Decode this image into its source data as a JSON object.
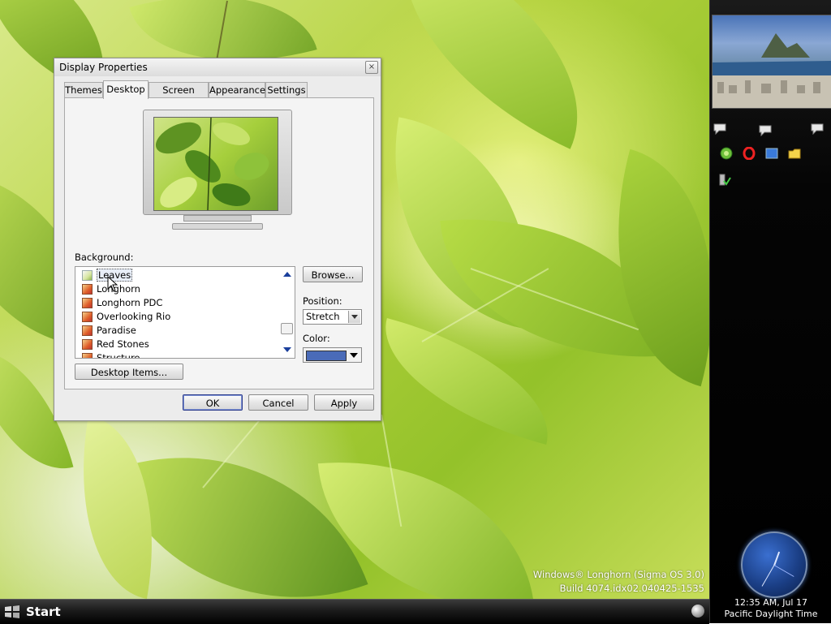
{
  "dialog": {
    "title": "Display Properties",
    "close_glyph": "×",
    "tabs": [
      {
        "label": "Themes",
        "active": false
      },
      {
        "label": "Desktop",
        "active": true
      },
      {
        "label": "Screen Saver",
        "active": false
      },
      {
        "label": "Appearance",
        "active": false
      },
      {
        "label": "Settings",
        "active": false
      }
    ],
    "background": {
      "label": "Background:",
      "items": [
        "Leaves",
        "Longhorn",
        "Longhorn PDC",
        "Overlooking Rio",
        "Paradise",
        "Red Stones",
        "Structure"
      ],
      "selected": "Leaves"
    },
    "browse_label": "Browse...",
    "position": {
      "label": "Position:",
      "value": "Stretch"
    },
    "color": {
      "label": "Color:",
      "value": "#4a6bb8"
    },
    "desktop_items_label": "Desktop Items...",
    "ok_label": "OK",
    "cancel_label": "Cancel",
    "apply_label": "Apply"
  },
  "taskbar": {
    "start_label": "Start"
  },
  "watermark": {
    "line1": "Windows® Longhorn (Sigma OS 3.0)",
    "line2": "Build 4074.idx02.040425-1535"
  },
  "sidebar": {
    "clock_time": "12:35 AM, Jul 17",
    "clock_zone": "Pacific Daylight Time",
    "icons": [
      "chat-icon",
      "chat-icon",
      "chat-icon",
      "globe-icon",
      "opera-icon",
      "screen-icon",
      "folder-icon",
      "task-icon"
    ]
  }
}
